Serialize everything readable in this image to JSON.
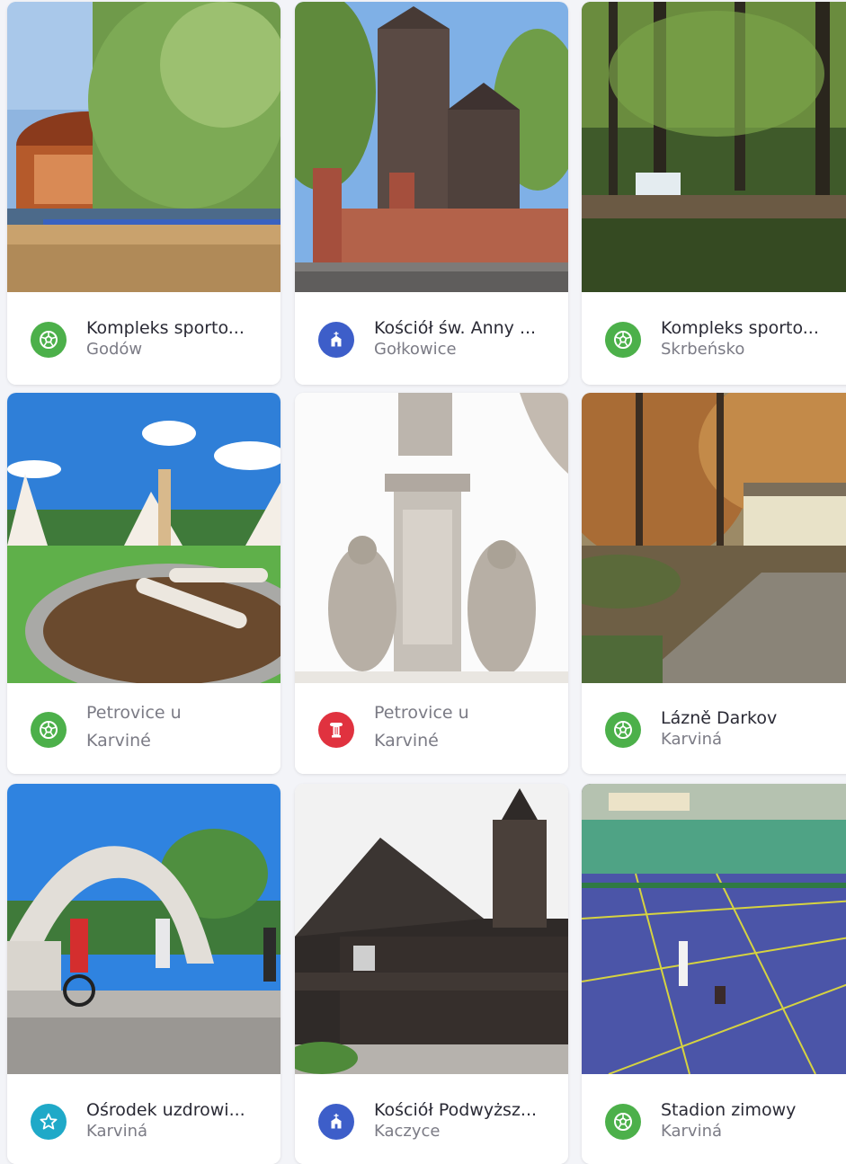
{
  "colors": {
    "sport_green": "#4cb04a",
    "church_blue": "#3d5ec9",
    "monument_red": "#e0323f",
    "spa_teal": "#1fa9c8"
  },
  "cards": [
    {
      "title": "Kompleks sporto...",
      "subtitle": "Godów",
      "icon": "soccer-ball-icon"
    },
    {
      "title": "Kościół św. Anny ...",
      "subtitle": "Gołkowice",
      "icon": "church-icon"
    },
    {
      "title": "Kompleks sporto...",
      "subtitle": "Skrbeńsko",
      "icon": "soccer-ball-icon"
    },
    {
      "title": "",
      "subtitle": "Petrovice u Karviné",
      "icon": "soccer-ball-icon"
    },
    {
      "title": "",
      "subtitle": "Petrovice u Karviné",
      "icon": "column-icon"
    },
    {
      "title": "Lázně Darkov",
      "subtitle": "Karviná",
      "icon": "soccer-ball-icon"
    },
    {
      "title": "Ośrodek uzdrowi...",
      "subtitle": "Karviná",
      "icon": "star-icon"
    },
    {
      "title": "Kościół Podwyższ...",
      "subtitle": "Kaczyce",
      "icon": "church-icon"
    },
    {
      "title": "Stadion zimowy",
      "subtitle": "Karviná",
      "icon": "soccer-ball-icon"
    }
  ]
}
